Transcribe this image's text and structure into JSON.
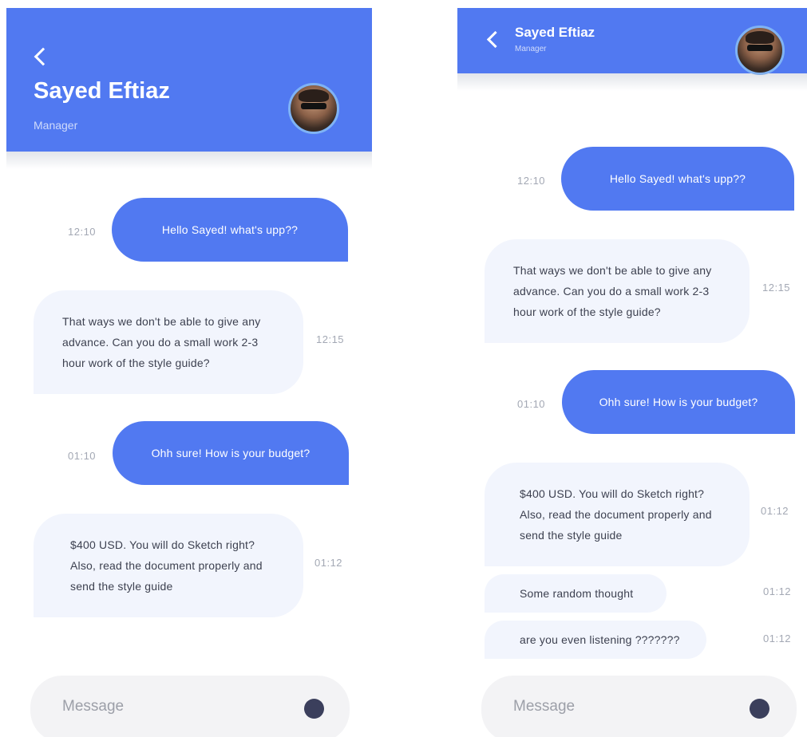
{
  "contact": {
    "name": "Sayed Eftiaz",
    "role": "Manager"
  },
  "messages": [
    {
      "text": "Hello Sayed! what's upp??",
      "time": "12:10",
      "direction": "outgoing"
    },
    {
      "text": "That ways we don't be able to give any advance. Can you do a small work 2-3 hour work of the style guide?",
      "time": "12:15",
      "direction": "incoming"
    },
    {
      "text": "Ohh sure! How is your budget?",
      "time": "01:10",
      "direction": "outgoing"
    },
    {
      "text": "$400 USD. You will do Sketch right? Also, read the document properly and send the style guide",
      "time": "01:12",
      "direction": "incoming"
    },
    {
      "text": "Some random thought",
      "time": "01:12",
      "direction": "incoming"
    },
    {
      "text": "are you even listening ???????",
      "time": "01:12",
      "direction": "incoming"
    }
  ],
  "composer": {
    "placeholder": "Message"
  },
  "icons": {
    "back": "chevron-left-icon",
    "send": "send-icon"
  },
  "colors": {
    "accent": "#5179f1",
    "incoming_bubble": "#f2f5fd",
    "send_button": "#3b3f5c"
  }
}
